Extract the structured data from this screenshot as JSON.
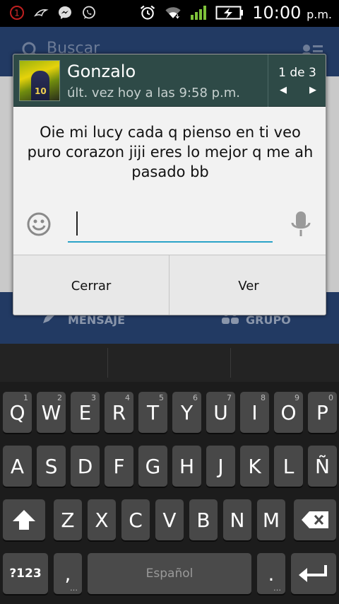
{
  "status_bar": {
    "notification_badge": "1",
    "time": "10:00",
    "time_suffix": "p.m.",
    "icons": [
      "notification-count-icon",
      "bird-icon",
      "messenger-icon",
      "whatsapp-icon",
      "alarm-icon",
      "wifi-icon",
      "signal-icon",
      "battery-charging-icon"
    ]
  },
  "background_app": {
    "search_placeholder": "Buscar",
    "bottom_left_label": "MENSAJE",
    "bottom_right_label": "GRUPO"
  },
  "popup": {
    "contact_name": "Gonzalo",
    "last_seen": "últ. vez hoy a las 9:58 p.m.",
    "avatar_number": "10",
    "pager": {
      "current": 1,
      "total": 3,
      "label": "1 de 3"
    },
    "message": "Oie mi lucy cada q pienso en ti veo puro corazon jiji eres lo mejor q me ah pasado bb",
    "reply_value": "",
    "close_label": "Cerrar",
    "view_label": "Ver"
  },
  "keyboard": {
    "rows": [
      [
        {
          "label": "Q",
          "hint": "1"
        },
        {
          "label": "W",
          "hint": "2"
        },
        {
          "label": "E",
          "hint": "3"
        },
        {
          "label": "R",
          "hint": "4"
        },
        {
          "label": "T",
          "hint": "5"
        },
        {
          "label": "Y",
          "hint": "6"
        },
        {
          "label": "U",
          "hint": "7"
        },
        {
          "label": "I",
          "hint": "8"
        },
        {
          "label": "O",
          "hint": "9"
        },
        {
          "label": "P",
          "hint": "0"
        }
      ],
      [
        {
          "label": "A"
        },
        {
          "label": "S"
        },
        {
          "label": "D"
        },
        {
          "label": "F"
        },
        {
          "label": "G"
        },
        {
          "label": "H"
        },
        {
          "label": "J"
        },
        {
          "label": "K"
        },
        {
          "label": "L"
        },
        {
          "label": "Ñ"
        }
      ],
      [
        {
          "label": "Z"
        },
        {
          "label": "X"
        },
        {
          "label": "C"
        },
        {
          "label": "V"
        },
        {
          "label": "B"
        },
        {
          "label": "N"
        },
        {
          "label": "M"
        }
      ]
    ],
    "symbols_label": "?123",
    "comma_label": ",",
    "space_label": "Español",
    "period_label": "."
  }
}
